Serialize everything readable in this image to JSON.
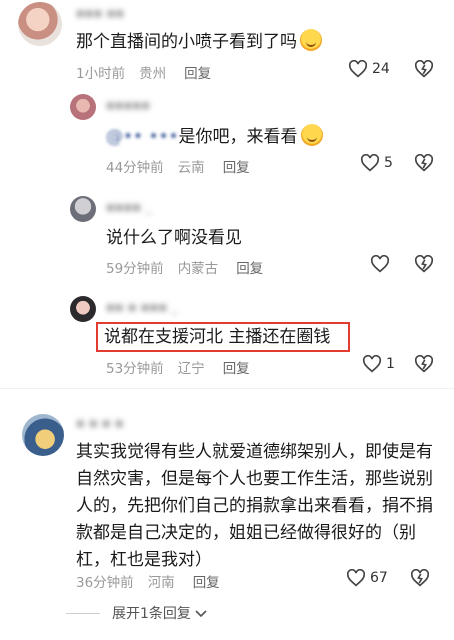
{
  "comments": [
    {
      "text": "那个直播间的小喷子看到了吗",
      "time": "1小时前",
      "location": "贵州",
      "reply": "回复",
      "likes": "24"
    },
    {
      "mention": "@•• •••",
      "text": "是你吧，来看看",
      "time": "44分钟前",
      "location": "云南",
      "reply": "回复",
      "likes": "5"
    },
    {
      "text": "说什么了啊没看见",
      "time": "59分钟前",
      "location": "内蒙古",
      "reply": "回复",
      "likes": ""
    },
    {
      "text": "说都在支援河北 主播还在圈钱",
      "time": "53分钟前",
      "location": "辽宁",
      "reply": "回复",
      "likes": "1"
    },
    {
      "text_lines": [
        "其实我觉得有些人就爱道德绑架别人，即使是有",
        "自然灾害，但是每个人也要工作生活，那些说别",
        "人的，先把你们自己的捐款拿出来看看，捐不捐",
        "款都是自己决定的，姐姐已经做得很好的（别",
        "杠，杠也是我对）"
      ],
      "time": "36分钟前",
      "location": "河南",
      "reply": "回复",
      "likes": "67"
    }
  ],
  "expand_replies": "展开1条回复",
  "highlight_color": "#e23b2f",
  "icons": [
    "heart-icon",
    "dislike-icon",
    "chevron-down-icon"
  ]
}
